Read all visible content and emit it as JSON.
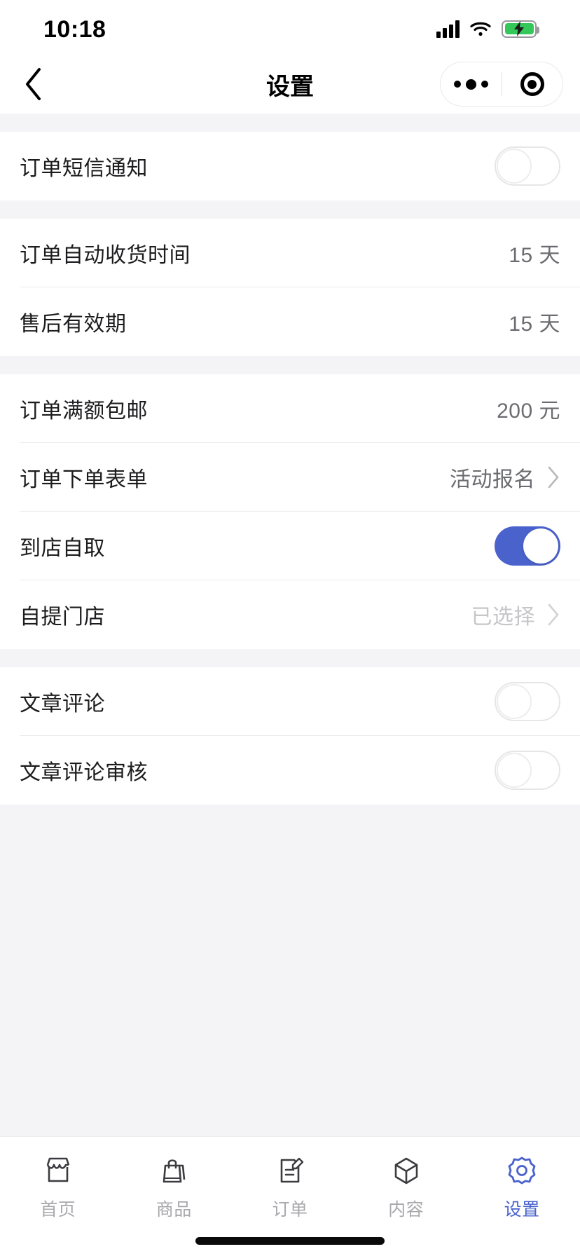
{
  "status_bar": {
    "time": "10:18",
    "signal_icon": "cellular-signal-icon",
    "wifi_icon": "wifi-icon",
    "battery_icon": "battery-charging-icon"
  },
  "nav_bar": {
    "back_icon": "chevron-left-icon",
    "title": "设置",
    "capsule": {
      "menu_icon": "more-dots-icon",
      "close_icon": "target-circle-icon"
    }
  },
  "colors": {
    "accent": "#4a62cc",
    "page_bg": "#f4f4f6",
    "card_bg": "#ffffff",
    "label": "#1c1c1e",
    "value": "#6b6b70",
    "value_muted": "#c6c6ca",
    "battery_green": "#34c759"
  },
  "groups": [
    {
      "rows": [
        {
          "label": "订单短信通知",
          "control": "switch",
          "switch_on": false
        }
      ]
    },
    {
      "rows": [
        {
          "label": "订单自动收货时间",
          "control": "value",
          "value": "15 天"
        },
        {
          "label": "售后有效期",
          "control": "value",
          "value": "15 天"
        }
      ]
    },
    {
      "rows": [
        {
          "label": "订单满额包邮",
          "control": "value",
          "value": "200 元"
        },
        {
          "label": "订单下单表单",
          "control": "link",
          "value": "活动报名",
          "chevron_icon": "chevron-right-icon"
        },
        {
          "label": "到店自取",
          "control": "switch",
          "switch_on": true
        },
        {
          "label": "自提门店",
          "control": "link-muted",
          "value": "已选择",
          "chevron_icon": "chevron-right-icon"
        }
      ]
    },
    {
      "rows": [
        {
          "label": "文章评论",
          "control": "switch",
          "switch_on": false
        },
        {
          "label": "文章评论审核",
          "control": "switch",
          "switch_on": false
        }
      ]
    }
  ],
  "tab_bar": {
    "items": [
      {
        "label": "首页",
        "icon": "storefront-icon",
        "active": false
      },
      {
        "label": "商品",
        "icon": "shopping-bag-icon",
        "active": false
      },
      {
        "label": "订单",
        "icon": "document-edit-icon",
        "active": false
      },
      {
        "label": "内容",
        "icon": "box-3d-icon",
        "active": false
      },
      {
        "label": "设置",
        "icon": "gear-icon",
        "active": true
      }
    ]
  }
}
